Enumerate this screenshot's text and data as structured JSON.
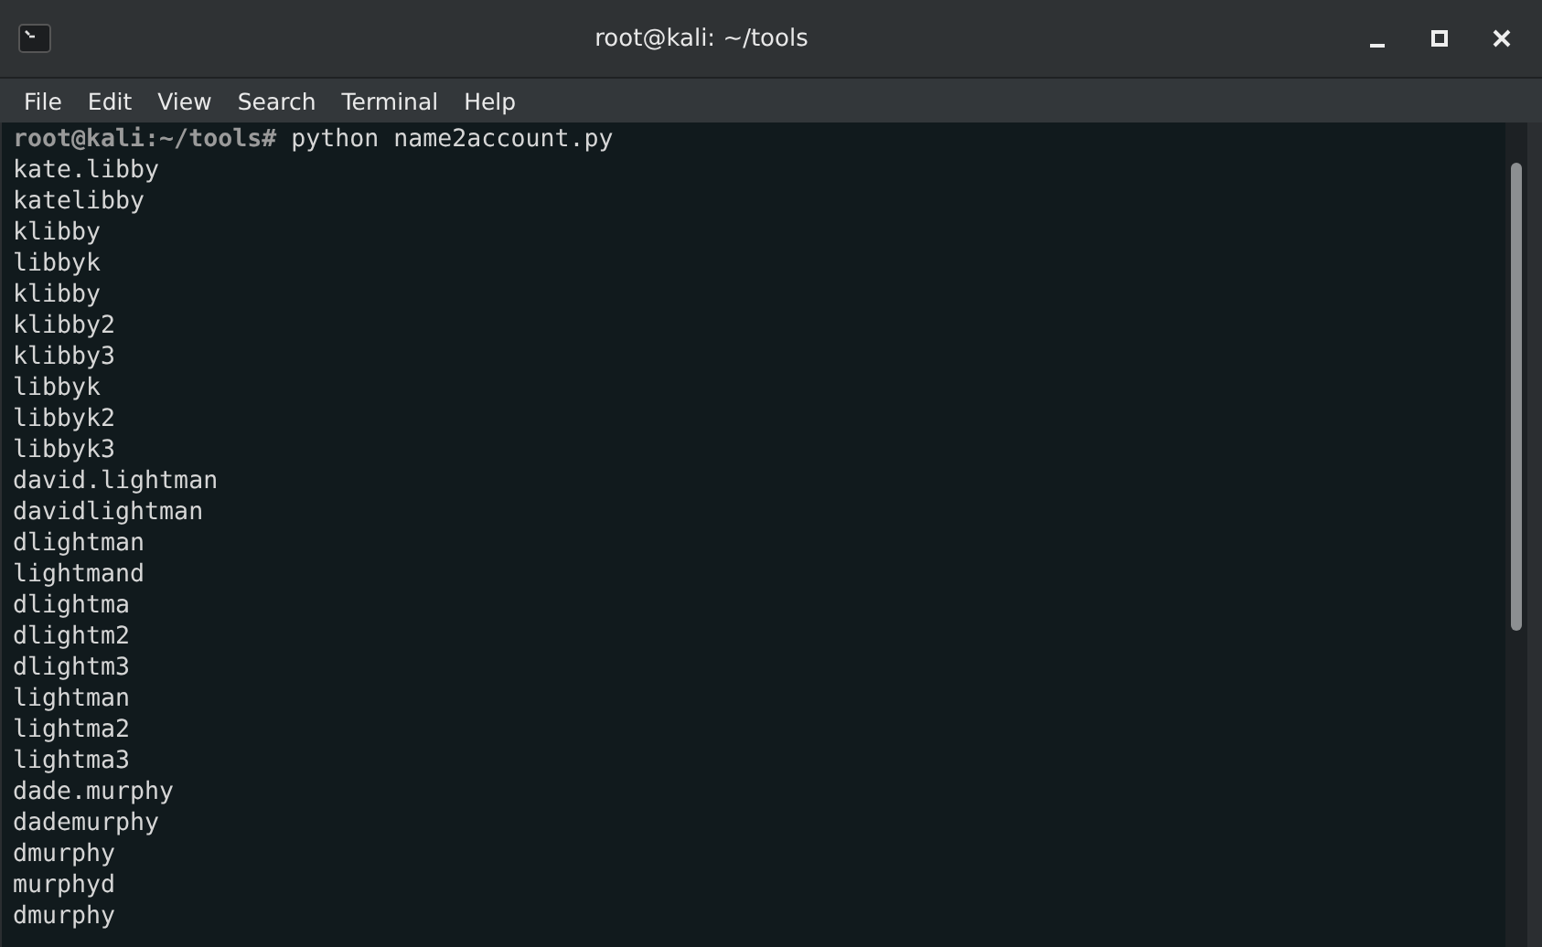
{
  "window": {
    "title": "root@kali: ~/tools"
  },
  "menu": [
    "File",
    "Edit",
    "View",
    "Search",
    "Terminal",
    "Help"
  ],
  "terminal": {
    "prompt": "root@kali:~/tools#",
    "command": "python name2account.py",
    "output": [
      "kate.libby",
      "katelibby",
      "klibby",
      "libbyk",
      "klibby",
      "klibby2",
      "klibby3",
      "libbyk",
      "libbyk2",
      "libbyk3",
      "david.lightman",
      "davidlightman",
      "dlightman",
      "lightmand",
      "dlightma",
      "dlightm2",
      "dlightm3",
      "lightman",
      "lightma2",
      "lightma3",
      "dade.murphy",
      "dademurphy",
      "dmurphy",
      "murphyd",
      "dmurphy"
    ]
  }
}
